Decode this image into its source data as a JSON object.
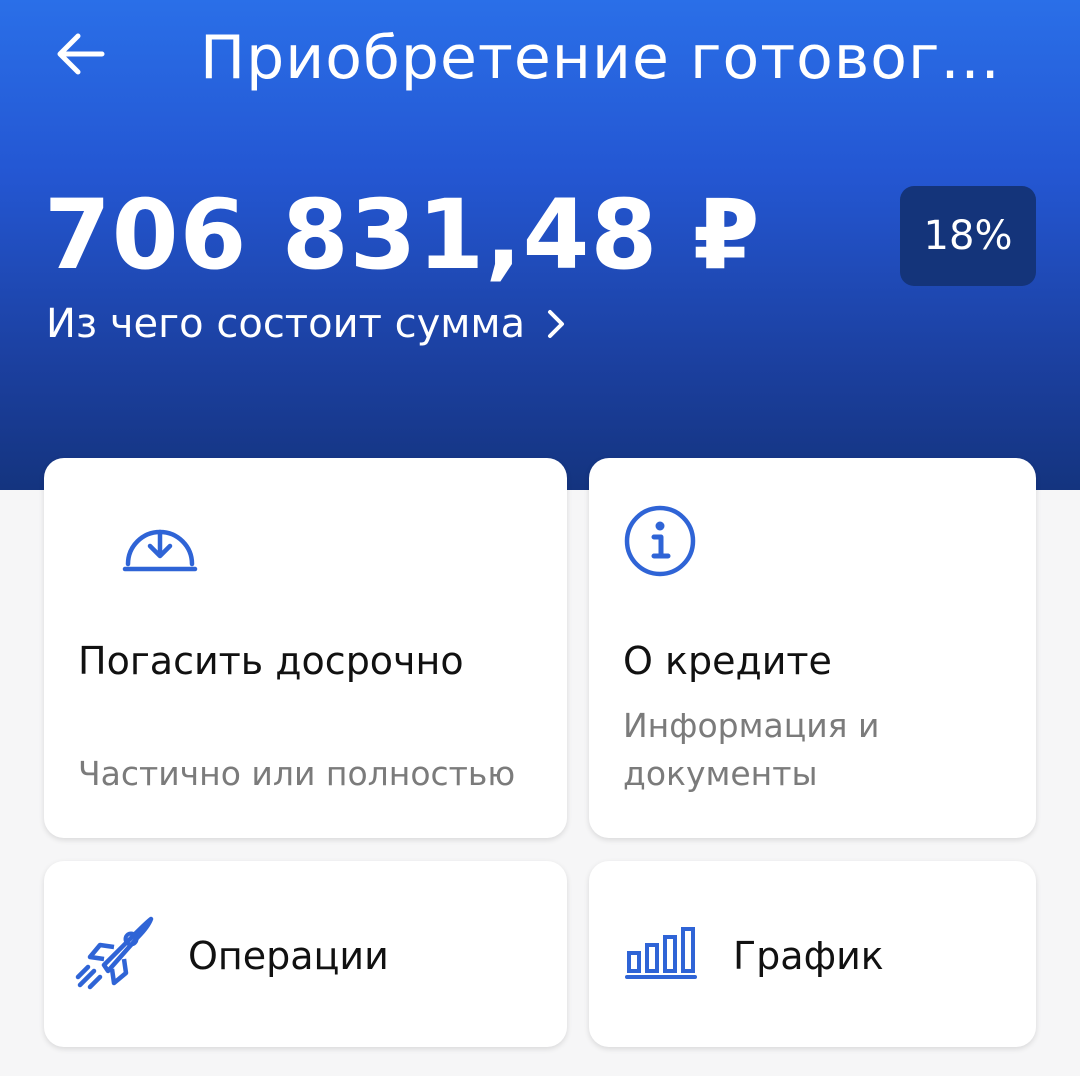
{
  "header": {
    "title": "Приобретение готовог...",
    "amount": "706 831,48 ₽",
    "breakdown_link": "Из чего состоит сумма",
    "rate": "18%"
  },
  "cards": {
    "early_repayment": {
      "title": "Погасить досрочно",
      "subtitle": "Частично или полностью"
    },
    "about_loan": {
      "title": "О кредите",
      "subtitle": "Информация и документы"
    },
    "operations": {
      "title": "Операции"
    },
    "schedule": {
      "title": "График"
    }
  },
  "colors": {
    "header_top": "#2a6fe8",
    "header_bottom": "#14347f",
    "badge_bg": "#14347a",
    "accent": "#2f64d6",
    "subtext": "#7b7b7b"
  },
  "icons": {
    "back": "arrow-left-icon",
    "chevron": "chevron-right-icon",
    "early_repayment": "download-gauge-icon",
    "about_loan": "info-circle-icon",
    "operations": "rocket-icon",
    "schedule": "bar-chart-icon"
  }
}
